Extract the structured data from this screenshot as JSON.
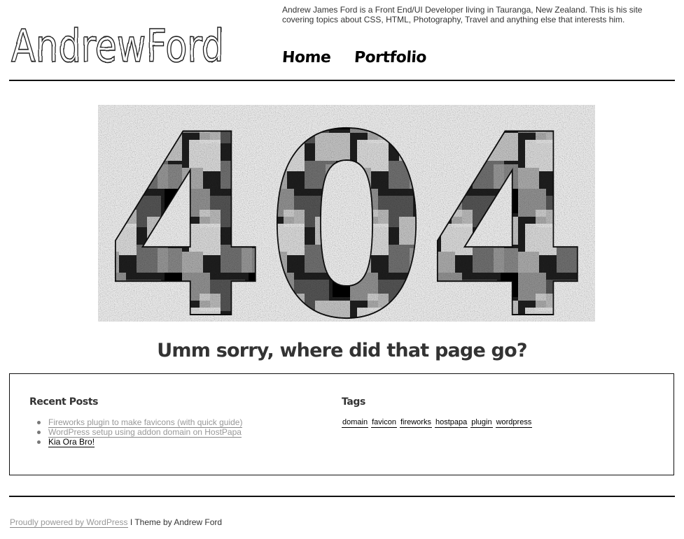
{
  "header": {
    "logo_text": "AndrewFord",
    "tagline": "Andrew James Ford is a Front End/UI Developer living in Tauranga, New Zealand. This is his site covering topics about CSS, HTML, Photography, Travel and anything else that interests him.",
    "nav": [
      {
        "label": "Home"
      },
      {
        "label": "Portfolio"
      }
    ]
  },
  "hero": {
    "big_text": "404",
    "message": "Umm sorry, where did that page go?"
  },
  "sidebar": {
    "recent_posts": {
      "title": "Recent Posts",
      "items": [
        {
          "label": "Fireworks plugin to make favicons (with quick guide)"
        },
        {
          "label": "WordPress setup using addon domain on HostPapa"
        },
        {
          "label": "Kia Ora Bro!"
        }
      ]
    },
    "tags": {
      "title": "Tags",
      "items": [
        "domain",
        "favicon",
        "fireworks",
        "hostpapa",
        "plugin",
        "wordpress"
      ]
    }
  },
  "footer": {
    "powered_by": "Proudly powered by WordPress",
    "theme_credit": " I Theme by Andrew Ford"
  }
}
